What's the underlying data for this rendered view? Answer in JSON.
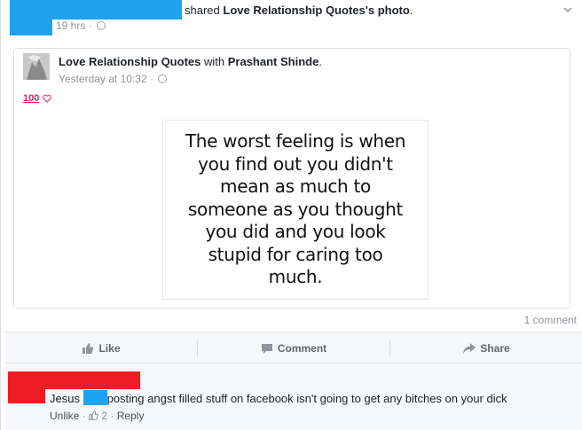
{
  "header": {
    "shared_text": "shared",
    "page_name": "Love Relationship Quotes",
    "possessive_suffix": "'s",
    "photo_link": "photo",
    "period": ".",
    "timestamp": "19 hrs",
    "meta_sep": "·"
  },
  "shared_post": {
    "page_name": "Love Relationship Quotes",
    "with_text": "with",
    "tagged_name": "Prashant Shinde",
    "period": ".",
    "timestamp": "Yesterday at 10:32",
    "meta_sep": "·",
    "emoji_text": "100",
    "quote": "The worst feeling is when you find out you didn't mean as much to someone as you thought you did and you look stupid for caring too much."
  },
  "stats": {
    "comment_count": "1 comment"
  },
  "actions": {
    "like_label": "Like",
    "comment_label": "Comment",
    "share_label": "Share"
  },
  "comment": {
    "text_before": "Jesus",
    "text_after": "posting angst filled stuff on facebook isn't going to get any bitches on your dick",
    "unlike_label": "Unlike",
    "like_count": "2",
    "reply_label": "Reply",
    "sep": "·"
  },
  "colors": {
    "redaction_blue": "#1fa2f0",
    "redaction_red": "#ee1c25"
  }
}
